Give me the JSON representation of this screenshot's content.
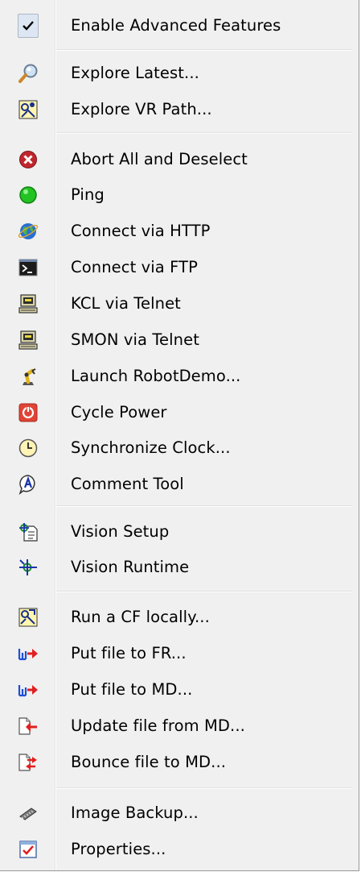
{
  "menu": {
    "items": [
      {
        "label": "Enable Advanced Features",
        "icon": "checkmark-icon",
        "checked": true
      },
      {
        "label": "Explore Latest...",
        "icon": "magnifier-icon"
      },
      {
        "label": "Explore VR Path...",
        "icon": "vr-path-icon"
      },
      {
        "label": "Abort All and Deselect",
        "icon": "abort-icon"
      },
      {
        "label": "Ping",
        "icon": "ping-icon"
      },
      {
        "label": "Connect via HTTP",
        "icon": "globe-icon"
      },
      {
        "label": "Connect via FTP",
        "icon": "terminal-icon"
      },
      {
        "label": "KCL via Telnet",
        "icon": "computer-icon"
      },
      {
        "label": "SMON via Telnet",
        "icon": "computer-icon"
      },
      {
        "label": "Launch RobotDemo...",
        "icon": "robot-icon"
      },
      {
        "label": "Cycle Power",
        "icon": "power-icon"
      },
      {
        "label": "Synchronize Clock...",
        "icon": "clock-icon"
      },
      {
        "label": "Comment Tool",
        "icon": "comment-icon"
      },
      {
        "label": "Vision Setup",
        "icon": "vision-setup-icon"
      },
      {
        "label": "Vision Runtime",
        "icon": "vision-runtime-icon"
      },
      {
        "label": "Run a CF locally...",
        "icon": "run-cf-icon"
      },
      {
        "label": "Put file to FR...",
        "icon": "put-file-icon"
      },
      {
        "label": "Put file to MD...",
        "icon": "put-file-icon"
      },
      {
        "label": "Update file from MD...",
        "icon": "update-file-icon"
      },
      {
        "label": "Bounce file to MD...",
        "icon": "bounce-file-icon"
      },
      {
        "label": "Image Backup...",
        "icon": "memory-chip-icon"
      },
      {
        "label": "Properties...",
        "icon": "properties-icon"
      }
    ]
  },
  "colors": {
    "menu_bg": "#f0f0f0",
    "abort_red": "#c0272d",
    "ping_green": "#22c322",
    "power_red": "#e04436",
    "arrow_red": "#e02020",
    "arrow_blue": "#1e4fd6"
  }
}
